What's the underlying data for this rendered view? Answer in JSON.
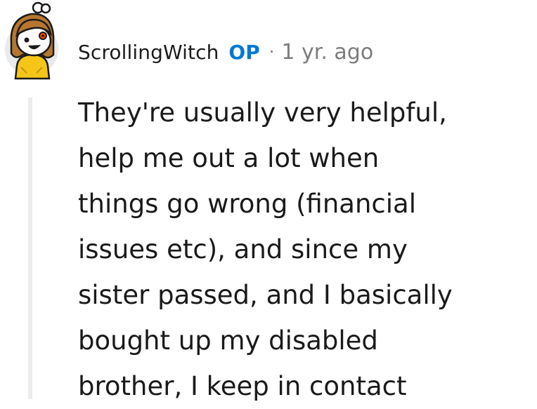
{
  "comment": {
    "username": "ScrollingWitch",
    "op_label": "OP",
    "separator": "·",
    "timestamp": "1 yr. ago",
    "body_lines": [
      "They're usually very helpful,",
      "help me out a lot when",
      "things go wrong (financial",
      "issues etc), and since my",
      "sister passed, and I basically",
      "bought up my disabled",
      "brother, I keep in contact"
    ]
  },
  "colors": {
    "op_badge": "#0079d3",
    "meta_gray": "#7c7c7c",
    "thread_line": "#ececec",
    "avatar_hair": "#b5772f",
    "avatar_body": "#f5c518"
  },
  "icons": {
    "avatar": "snoo-avatar-icon"
  }
}
